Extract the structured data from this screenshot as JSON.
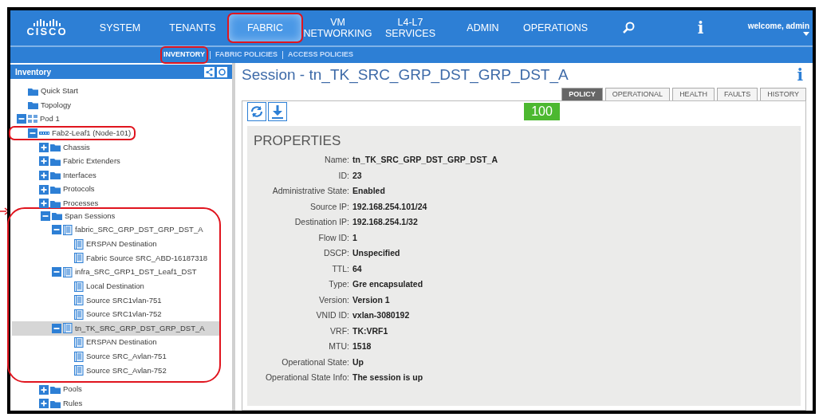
{
  "nav": {
    "logo": "CISCO",
    "items": [
      {
        "kind": "text",
        "label": "SYSTEM",
        "selected": false,
        "highlighted": false
      },
      {
        "kind": "text",
        "label": "TENANTS",
        "selected": false,
        "highlighted": false
      },
      {
        "kind": "text",
        "label": "FABRIC",
        "selected": true,
        "highlighted": true
      },
      {
        "kind": "text",
        "label": "VM NETWORKING",
        "selected": false,
        "highlighted": false
      },
      {
        "kind": "text",
        "label": "L4-L7 SERVICES",
        "selected": false,
        "highlighted": false
      },
      {
        "kind": "text",
        "label": "ADMIN",
        "selected": false,
        "highlighted": false
      },
      {
        "kind": "text",
        "label": "OPERATIONS",
        "selected": false,
        "highlighted": false
      },
      {
        "kind": "search",
        "selected": false,
        "highlighted": false
      },
      {
        "kind": "info",
        "label": "i",
        "selected": false,
        "highlighted": false
      }
    ],
    "user": "welcome, admin"
  },
  "subnav": [
    {
      "label": "INVENTORY",
      "selected": true,
      "highlighted": true
    },
    {
      "label": "FABRIC POLICIES",
      "selected": false,
      "highlighted": false
    },
    {
      "label": "ACCESS POLICIES",
      "selected": false,
      "highlighted": false
    }
  ],
  "sidebar": {
    "title": "Inventory",
    "tree": [
      {
        "label": "Quick Start",
        "kind": "folder",
        "selected": false
      },
      {
        "label": "Topology",
        "kind": "folder",
        "selected": false
      },
      {
        "label": "Pod 1",
        "kind": "pod",
        "expanded": true,
        "selected": false,
        "children": [
          {
            "label": "Fab2-Leaf1 (Node-101)",
            "kind": "leaf",
            "expanded": true,
            "selected": false,
            "highlighted": true,
            "children": [
              {
                "label": "Chassis",
                "kind": "folder",
                "expanded": false,
                "selected": false
              },
              {
                "label": "Fabric Extenders",
                "kind": "folder",
                "expanded": false,
                "selected": false
              },
              {
                "label": "Interfaces",
                "kind": "folder",
                "expanded": false,
                "selected": false
              },
              {
                "label": "Protocols",
                "kind": "folder",
                "expanded": false,
                "selected": false
              },
              {
                "label": "Processes",
                "kind": "folder",
                "expanded": false,
                "selected": false
              },
              {
                "label": "Span Sessions",
                "kind": "folder",
                "expanded": true,
                "selected": false,
                "highlighted": true,
                "children": [
                  {
                    "label": "fabric_SRC_GRP_DST_GRP_DST_A",
                    "kind": "doc",
                    "expanded": true,
                    "selected": false,
                    "children": [
                      {
                        "label": "ERSPAN Destination",
                        "kind": "doc",
                        "selected": false
                      },
                      {
                        "label": "Fabric Source SRC_ABD-16187318",
                        "kind": "doc",
                        "selected": false
                      }
                    ]
                  },
                  {
                    "label": "infra_SRC_GRP1_DST_Leaf1_DST",
                    "kind": "doc",
                    "expanded": true,
                    "selected": false,
                    "children": [
                      {
                        "label": "Local Destination",
                        "kind": "doc",
                        "selected": false
                      },
                      {
                        "label": "Source SRC1vlan-751",
                        "kind": "doc",
                        "selected": false
                      },
                      {
                        "label": "Source SRC1vlan-752",
                        "kind": "doc",
                        "selected": false
                      }
                    ]
                  },
                  {
                    "label": "tn_TK_SRC_GRP_DST_GRP_DST_A",
                    "kind": "doc",
                    "expanded": true,
                    "selected": true,
                    "children": [
                      {
                        "label": "ERSPAN Destination",
                        "kind": "doc",
                        "selected": false
                      },
                      {
                        "label": "Source SRC_Avlan-751",
                        "kind": "doc",
                        "selected": false
                      },
                      {
                        "label": "Source SRC_Avlan-752",
                        "kind": "doc",
                        "selected": false
                      }
                    ]
                  }
                ]
              },
              {
                "label": "Pools",
                "kind": "folder",
                "expanded": false,
                "selected": false
              },
              {
                "label": "Rules",
                "kind": "folder",
                "expanded": false,
                "selected": false
              }
            ]
          }
        ]
      }
    ]
  },
  "main": {
    "title": "Session - tn_TK_SRC_GRP_DST_GRP_DST_A",
    "info": "i",
    "tabs": [
      {
        "label": "POLICY",
        "selected": true
      },
      {
        "label": "OPERATIONAL",
        "selected": false
      },
      {
        "label": "HEALTH",
        "selected": false
      },
      {
        "label": "FAULTS",
        "selected": false
      },
      {
        "label": "HISTORY",
        "selected": false
      }
    ],
    "health": "100",
    "properties": {
      "title": "PROPERTIES",
      "fields": [
        {
          "label": "Name:",
          "value": "tn_TK_SRC_GRP_DST_GRP_DST_A"
        },
        {
          "label": "ID:",
          "value": "23"
        },
        {
          "label": "Administrative State:",
          "value": "Enabled"
        },
        {
          "label": "Source IP:",
          "value": "192.168.254.101/24"
        },
        {
          "label": "Destination IP:",
          "value": "192.168.254.1/32"
        },
        {
          "label": "Flow ID:",
          "value": "1"
        },
        {
          "label": "DSCP:",
          "value": "Unspecified"
        },
        {
          "label": "TTL:",
          "value": "64"
        },
        {
          "label": "Type:",
          "value": "Gre encapsulated"
        },
        {
          "label": "Version:",
          "value": "Version 1"
        },
        {
          "label": "VNID ID:",
          "value": "vxlan-3080192"
        },
        {
          "label": "VRF:",
          "value": "TK:VRF1"
        },
        {
          "label": "MTU:",
          "value": "1518"
        },
        {
          "label": "Operational State:",
          "value": "Up"
        },
        {
          "label": "Operational State Info:",
          "value": "The session is up"
        }
      ]
    }
  }
}
